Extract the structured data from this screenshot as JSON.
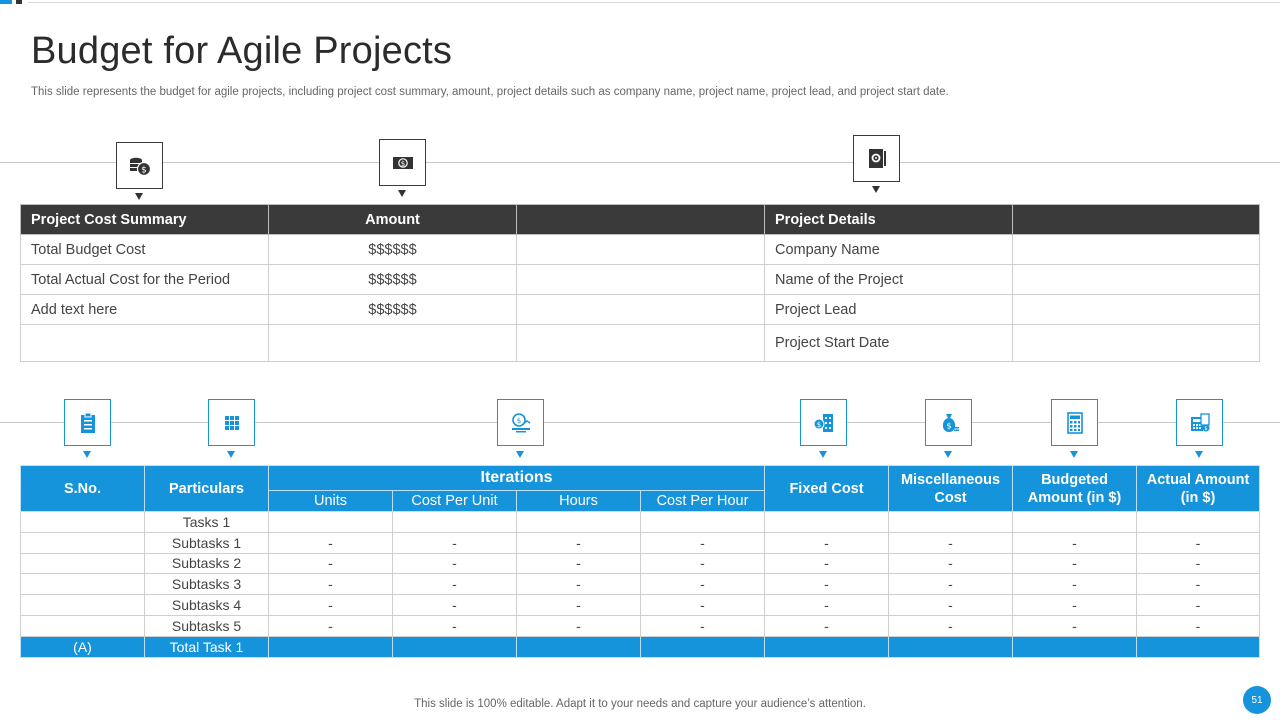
{
  "slide": {
    "title": "Budget for Agile Projects",
    "subtitle": "This slide represents the budget for agile projects, including project cost summary, amount, project details such as company name, project name, project lead, and project start date.",
    "footer": "This slide is 100% editable. Adapt it to your needs and capture your audience’s attention.",
    "page_number": "51"
  },
  "colors": {
    "accent": "#1594dc",
    "header_dark": "#3a3a3a"
  },
  "icons_top": [
    "coins-dollar-icon",
    "banknote-icon",
    "document-gear-icon"
  ],
  "icons_bottom": [
    "clipboard-icon",
    "grid-icon",
    "monitor-chart-icon",
    "building-dollar-icon",
    "money-bag-icon",
    "calculator-icon",
    "calculator-invoice-icon"
  ],
  "summary_table": {
    "headers": [
      "Project Cost Summary",
      "Amount",
      "",
      "Project Details",
      ""
    ],
    "rows": [
      [
        "Total Budget Cost",
        "$$$$$$",
        "",
        "Company Name",
        ""
      ],
      [
        "Total Actual Cost for the Period",
        "$$$$$$",
        "",
        "Name of the Project",
        ""
      ],
      [
        "Add text here",
        "$$$$$$",
        "",
        "Project Lead",
        ""
      ],
      [
        "",
        "",
        "",
        "Project Start Date",
        ""
      ]
    ]
  },
  "task_table": {
    "headers": {
      "sno": "S.No.",
      "particulars": "Particulars",
      "iterations": "Iterations",
      "iteration_cols": [
        "Units",
        "Cost Per Unit",
        "Hours",
        "Cost Per Hour"
      ],
      "fixed_cost": "Fixed Cost",
      "misc_cost": "Miscellaneous Cost",
      "budgeted": "Budgeted Amount (in $)",
      "actual": "Actual Amount (in $)"
    },
    "rows": [
      [
        "",
        "Tasks 1",
        "",
        "",
        "",
        "",
        "",
        "",
        "",
        ""
      ],
      [
        "",
        "Subtasks 1",
        "-",
        "-",
        "-",
        "-",
        "-",
        "-",
        "-",
        "-"
      ],
      [
        "",
        "Subtasks 2",
        "-",
        "-",
        "-",
        "-",
        "-",
        "-",
        "-",
        "-"
      ],
      [
        "",
        "Subtasks 3",
        "-",
        "-",
        "-",
        "-",
        "-",
        "-",
        "-",
        "-"
      ],
      [
        "",
        "Subtasks 4",
        "-",
        "-",
        "-",
        "-",
        "-",
        "-",
        "-",
        "-"
      ],
      [
        "",
        "Subtasks 5",
        "-",
        "-",
        "-",
        "-",
        "-",
        "-",
        "-",
        "-"
      ]
    ],
    "total_row": [
      "(A)",
      "Total Task 1",
      "",
      "",
      "",
      "",
      "",
      "",
      "",
      ""
    ]
  }
}
